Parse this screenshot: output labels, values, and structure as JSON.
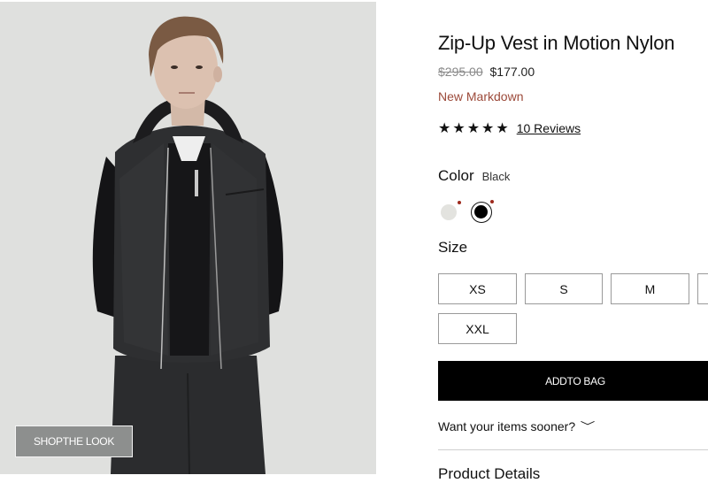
{
  "product": {
    "title": "Zip-Up Vest in Motion Nylon",
    "price_original": "$295.00",
    "price_sale": "$177.00",
    "badge": "New Markdown",
    "rating_stars": "★★★★★",
    "rating_value": 5,
    "reviews_label": "10 Reviews"
  },
  "color": {
    "label": "Color",
    "selected": "Black",
    "swatches": [
      {
        "name": "light",
        "color": "#e3e3df"
      },
      {
        "name": "black",
        "color": "#000000"
      }
    ],
    "dot_color": "#9e2a1d"
  },
  "size": {
    "label": "Size",
    "options": [
      "XS",
      "S",
      "M",
      "XXL"
    ]
  },
  "actions": {
    "add_to_bag": "ADDTO BAG",
    "shop_the_look": "SHOPTHE LOOK",
    "delivery_prompt": "Want your items sooner?"
  },
  "sections": {
    "product_details": "Product Details"
  },
  "colors": {
    "accent_markdown": "#9c4a3a",
    "button_bg": "#000000",
    "image_bg": "#dfe0de"
  }
}
